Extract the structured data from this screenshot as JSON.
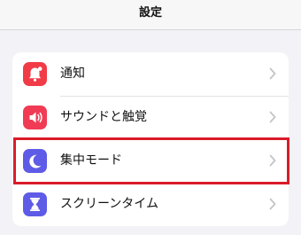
{
  "header": {
    "title": "設定"
  },
  "settings": {
    "items": [
      {
        "label": "通知",
        "icon": "bell-icon",
        "icon_color": "#f13b47"
      },
      {
        "label": "サウンドと触覚",
        "icon": "speaker-icon",
        "icon_color": "#f13b54"
      },
      {
        "label": "集中モード",
        "icon": "moon-icon",
        "icon_color": "#5e5ce6"
      },
      {
        "label": "スクリーンタイム",
        "icon": "hourglass-icon",
        "icon_color": "#5e5ce6"
      }
    ]
  },
  "highlight": {
    "color": "#d91c2a",
    "target": "集中モード"
  }
}
